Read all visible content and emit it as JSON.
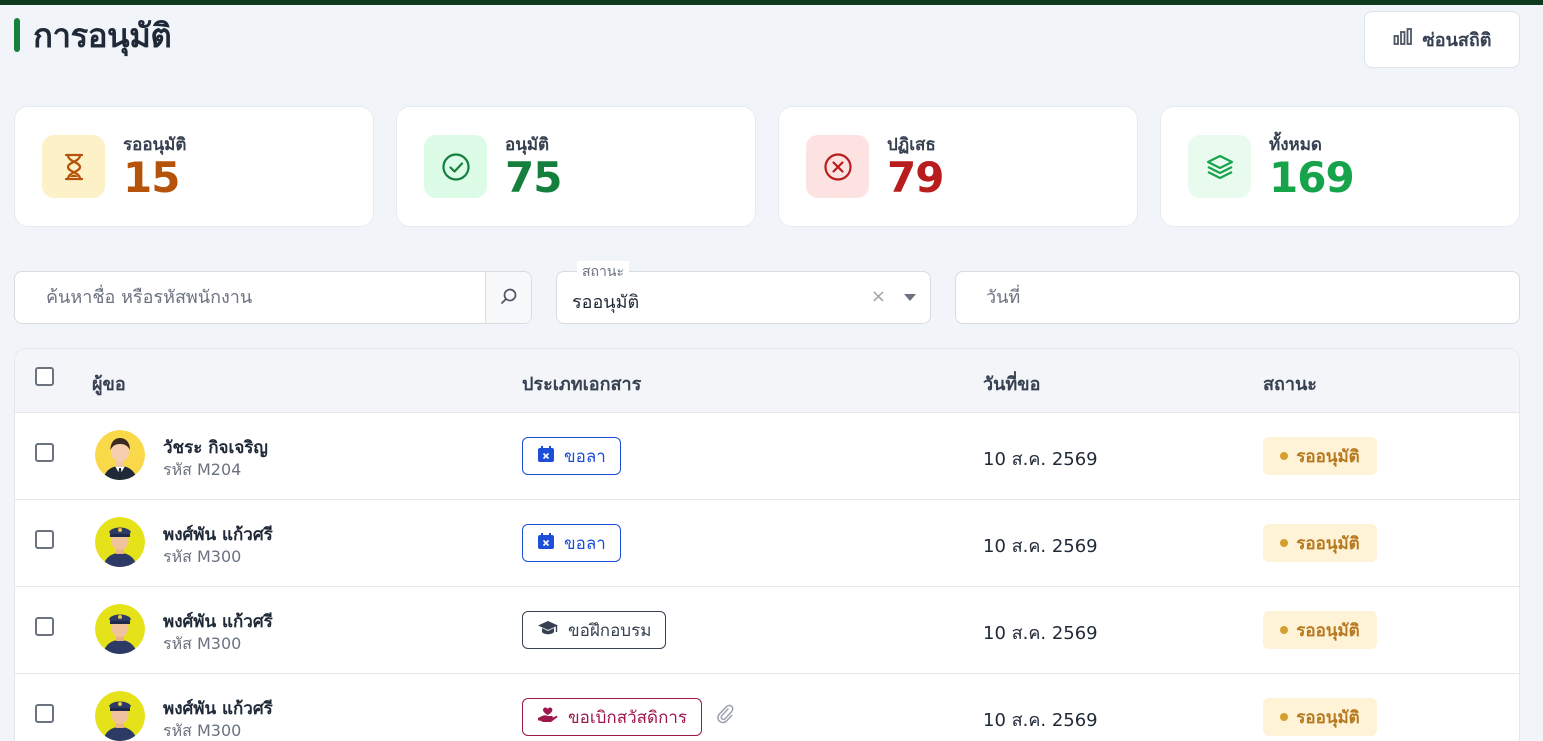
{
  "header": {
    "title": "การอนุมัติ",
    "hide_stats_label": "ซ่อนสถิติ"
  },
  "stats": [
    {
      "label": "รออนุมัติ",
      "value": "15",
      "color": "#b45309",
      "icon": "hourglass-icon"
    },
    {
      "label": "อนุมัติ",
      "value": "75",
      "color": "#15803d",
      "icon": "check-circle-icon"
    },
    {
      "label": "ปฏิเสธ",
      "value": "79",
      "color": "#b91c1c",
      "icon": "x-circle-icon"
    },
    {
      "label": "ทั้งหมด",
      "value": "169",
      "color": "#16a34a",
      "icon": "layers-icon"
    }
  ],
  "filters": {
    "search_placeholder": "ค้นหาชื่อ หรือรหัสพนักงาน",
    "status_label": "สถานะ",
    "status_value": "รออนุมัติ",
    "status_clear": "×",
    "date_placeholder": "วันที่"
  },
  "table": {
    "columns": [
      "ผู้ขอ",
      "ประเภทเอกสาร",
      "วันที่ขอ",
      "สถานะ"
    ],
    "rows": [
      {
        "name": "วัชระ กิจเจริญ",
        "code": "รหัส M204",
        "doc_type": "ขอลา",
        "doc_icon": "calendar-x-icon",
        "has_attachment": false,
        "date": "10 ส.ค. 2569",
        "status": "รออนุมัติ",
        "avatar": "businessman-avatar"
      },
      {
        "name": "พงศ์พัน แก้วศรี",
        "code": "รหัส M300",
        "doc_type": "ขอลา",
        "doc_icon": "calendar-x-icon",
        "has_attachment": false,
        "date": "10 ส.ค. 2569",
        "status": "รออนุมัติ",
        "avatar": "police-avatar"
      },
      {
        "name": "พงศ์พัน แก้วศรี",
        "code": "รหัส M300",
        "doc_type": "ขอฝึกอบรม",
        "doc_icon": "graduation-cap-icon",
        "has_attachment": false,
        "date": "10 ส.ค. 2569",
        "status": "รออนุมัติ",
        "avatar": "police-avatar"
      },
      {
        "name": "พงศ์พัน แก้วศรี",
        "code": "รหัส M300",
        "doc_type": "ขอเบิกสวัสดิการ",
        "doc_icon": "heart-hand-icon",
        "has_attachment": true,
        "date": "10 ส.ค. 2569",
        "status": "รออนุมัติ",
        "avatar": "police-avatar"
      }
    ]
  },
  "colors": {
    "accent": "#16803c",
    "leave_tag": "#1d4ed8",
    "training_tag": "#374151",
    "welfare_tag": "#9d174d",
    "pending_badge_bg": "#fef3d7",
    "pending_badge_text": "#b7791f"
  }
}
